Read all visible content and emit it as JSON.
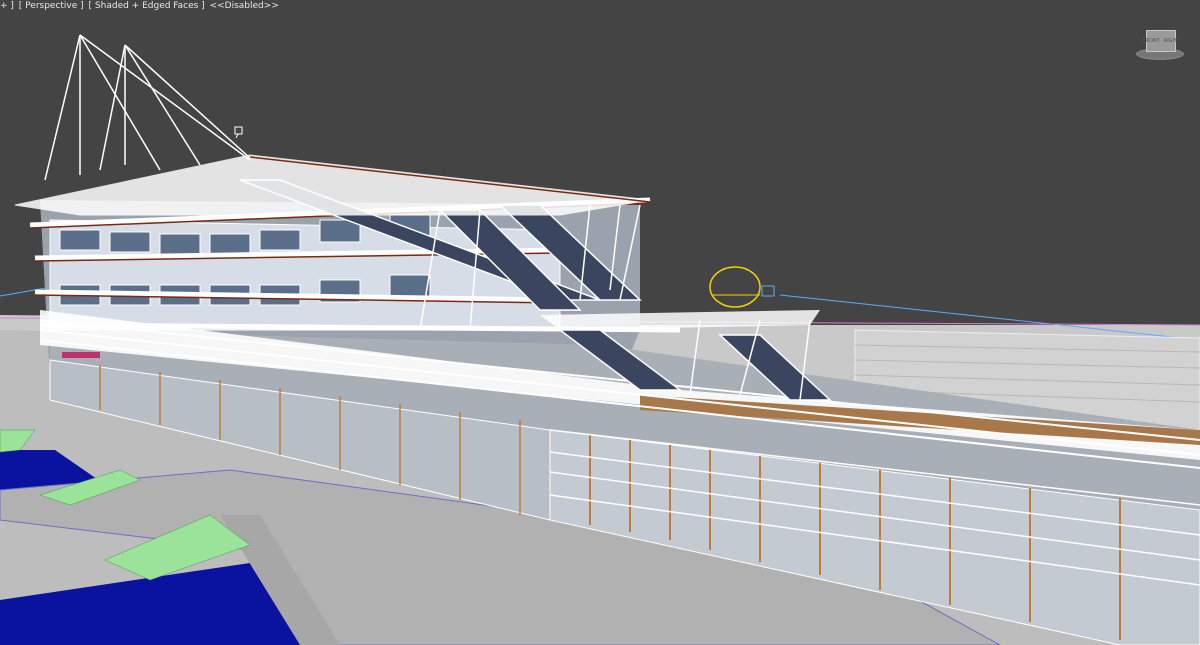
{
  "viewport": {
    "label_plus": "+ ]",
    "label_view": "[ Perspective ]",
    "label_shading": "[ Shaded + Edged Faces ]",
    "label_disabled": "<<Disabled>>",
    "viewcube_face_left": "FRONT",
    "viewcube_face_right": "RIGHT"
  },
  "colors": {
    "background": "#444444",
    "ground": "#bdbdbd",
    "water": "#0a12a0",
    "steps": "#9be39b",
    "wireframe": "#ffffff",
    "glass": "#5b6e8a",
    "wood": "#a8784a",
    "selection": "#f2d200",
    "guide_line": "#5fa8ff"
  },
  "icons": [
    "light-icon",
    "camera-target-icon",
    "viewcube-icon"
  ]
}
